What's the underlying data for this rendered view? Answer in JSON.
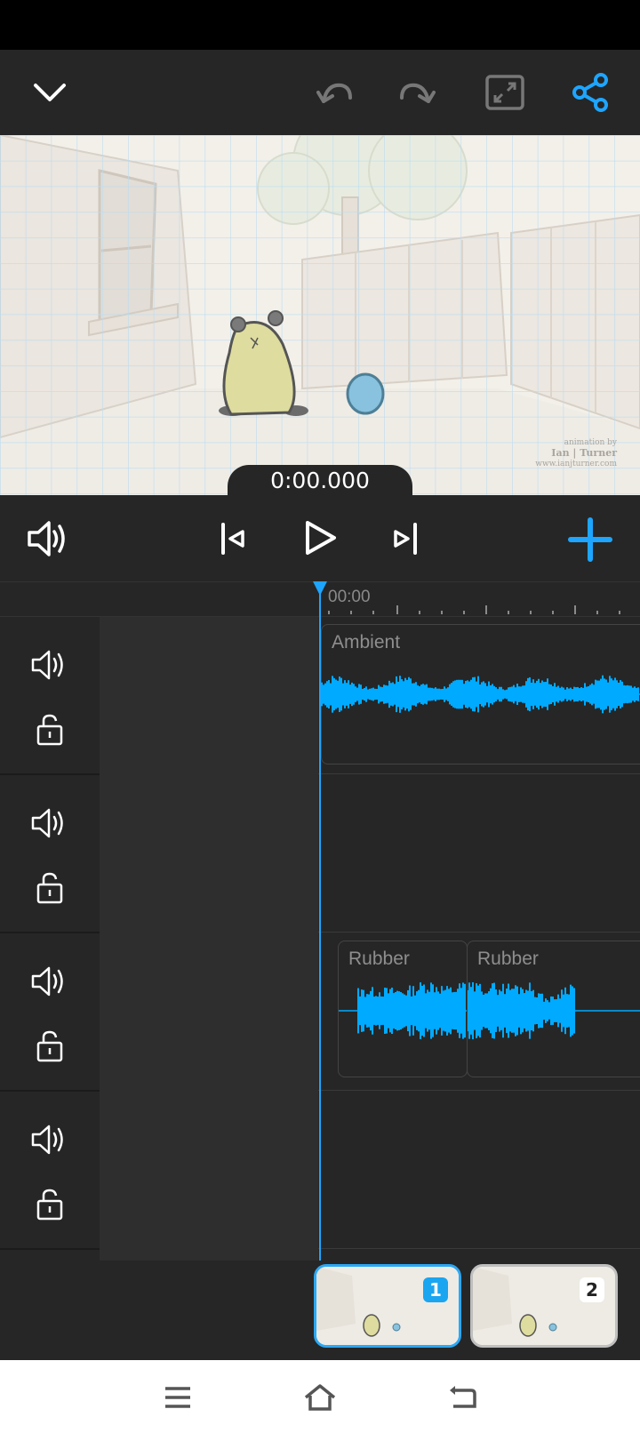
{
  "top_bar": {
    "collapse": "chevron-down-icon",
    "undo": "undo-icon",
    "redo": "redo-icon",
    "fullscreen": "fullscreen-icon",
    "share": "share-icon"
  },
  "preview": {
    "timecode": "0:00.000",
    "credit_line1": "animation by",
    "credit_line2": "Ian | Turner",
    "credit_line3": "www.ianjturner.com"
  },
  "playback": {
    "volume": "volume-icon",
    "skip_start": "skip-start-icon",
    "play": "play-icon",
    "skip_end": "skip-end-icon",
    "add": "plus-icon"
  },
  "timeline": {
    "ruler_start": "00:00",
    "tracks": [
      {
        "clips": [
          {
            "label": "Ambient"
          }
        ]
      },
      {
        "clips": []
      },
      {
        "clips": [
          {
            "label": "Rubber"
          },
          {
            "label": "Rubber"
          }
        ]
      },
      {
        "clips": []
      }
    ]
  },
  "scenes": [
    {
      "number": "1",
      "selected": true
    },
    {
      "number": "2",
      "selected": false
    }
  ],
  "colors": {
    "accent": "#1ea5ff",
    "waveform": "#00aaff",
    "panel": "#262626"
  },
  "nav": {
    "menu": "menu-icon",
    "home": "home-icon",
    "back": "back-icon"
  }
}
